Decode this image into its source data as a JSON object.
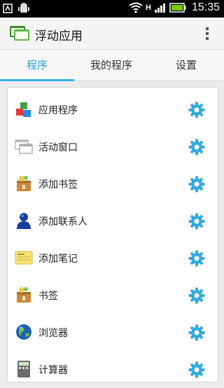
{
  "status_bar": {
    "time": "15:35",
    "network_label": "H"
  },
  "action_bar": {
    "title": "浮动应用"
  },
  "tabs": [
    {
      "label": "程序",
      "active": true
    },
    {
      "label": "我的程序",
      "active": false
    },
    {
      "label": "设置",
      "active": false
    }
  ],
  "list": [
    {
      "label": "应用程序",
      "icon": "app-blocks-icon"
    },
    {
      "label": "活动窗口",
      "icon": "windows-icon"
    },
    {
      "label": "添加书签",
      "icon": "bookmark-icon"
    },
    {
      "label": "添加联系人",
      "icon": "contact-icon"
    },
    {
      "label": "添加笔记",
      "icon": "note-icon"
    },
    {
      "label": "书签",
      "icon": "bookmark-icon"
    },
    {
      "label": "浏览器",
      "icon": "globe-icon"
    },
    {
      "label": "计算器",
      "icon": "calculator-icon"
    }
  ],
  "colors": {
    "accent": "#33b5e5",
    "gear": "#33aadd"
  }
}
